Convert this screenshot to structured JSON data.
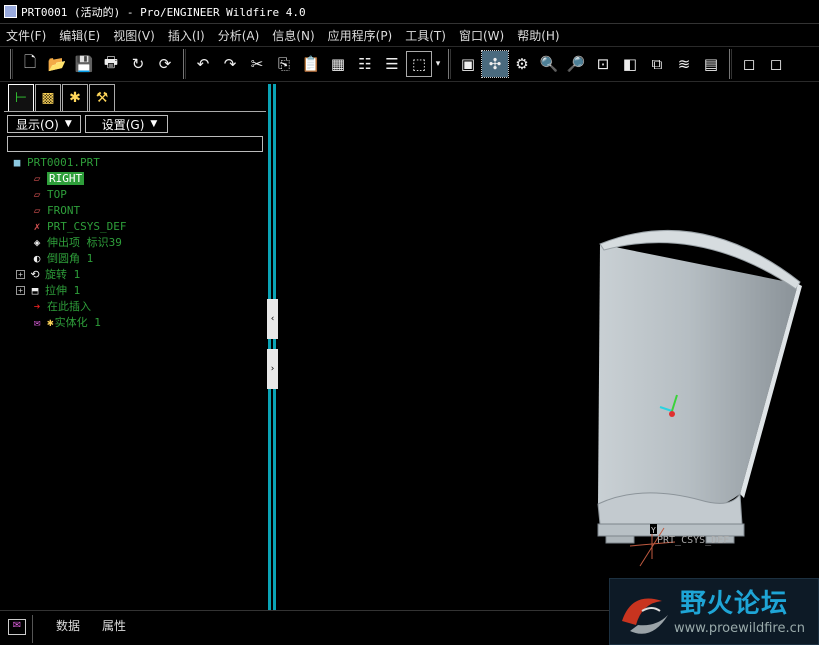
{
  "window": {
    "title": "PRT0001 (活动的) - Pro/ENGINEER Wildfire 4.0"
  },
  "menu": [
    "文件(F)",
    "编辑(E)",
    "视图(V)",
    "插入(I)",
    "分析(A)",
    "信息(N)",
    "应用程序(P)",
    "工具(T)",
    "窗口(W)",
    "帮助(H)"
  ],
  "toolbar": {
    "file_group": [
      "new-icon",
      "open-icon",
      "save-icon",
      "print-icon",
      "send-mail-icon",
      "save-copy-icon"
    ],
    "edit_group": [
      "undo-icon",
      "redo-icon",
      "cut-icon",
      "copy-icon",
      "paste-icon",
      "paste-special-icon",
      "regenerate-icon",
      "regen-manager-icon",
      "select-box-icon"
    ],
    "view_group": [
      "repaint-icon",
      "spin-center-icon",
      "orient-mode-icon",
      "zoom-in-icon",
      "zoom-out-icon",
      "refit-icon",
      "reorient-icon",
      "saved-views-icon",
      "layers-icon",
      "view-manager-icon"
    ],
    "display_group": [
      "wireframe-icon",
      "hidden-line-icon"
    ]
  },
  "panel": {
    "dropdowns": {
      "display": "显示(O)",
      "settings": "设置(G)"
    },
    "search_value": "",
    "tree": [
      {
        "label": "PRT0001.PRT",
        "icon": "part-icon",
        "expandable": false,
        "highlight": false
      },
      {
        "label": "RIGHT",
        "icon": "datum-plane-icon",
        "expandable": false,
        "highlight": true
      },
      {
        "label": "TOP",
        "icon": "datum-plane-icon",
        "expandable": false,
        "highlight": false
      },
      {
        "label": "FRONT",
        "icon": "datum-plane-icon",
        "expandable": false,
        "highlight": false
      },
      {
        "label": "PRT_CSYS_DEF",
        "icon": "csys-icon",
        "expandable": false,
        "highlight": false
      },
      {
        "label": "伸出项 标识39",
        "icon": "protrusion-icon",
        "expandable": false,
        "highlight": false
      },
      {
        "label": "倒圆角 1",
        "icon": "round-icon",
        "expandable": false,
        "highlight": false
      },
      {
        "label": "旋转 1",
        "icon": "revolve-icon",
        "expandable": true,
        "highlight": false
      },
      {
        "label": "拉伸 1",
        "icon": "extrude-icon",
        "expandable": true,
        "highlight": false
      },
      {
        "label": "在此插入",
        "icon": "insert-here-icon",
        "expandable": false,
        "highlight": false
      },
      {
        "label": "实体化 1",
        "icon": "solidify-icon",
        "expandable": false,
        "highlight": false
      }
    ]
  },
  "graphics": {
    "csys_label": "PRT_CSYS_DEF",
    "axis_y_label": "Y"
  },
  "watermark": {
    "title": "野火论坛",
    "url": "www.proewildfire.cn"
  },
  "bottom": {
    "tabs": [
      "数据",
      "属性"
    ]
  }
}
